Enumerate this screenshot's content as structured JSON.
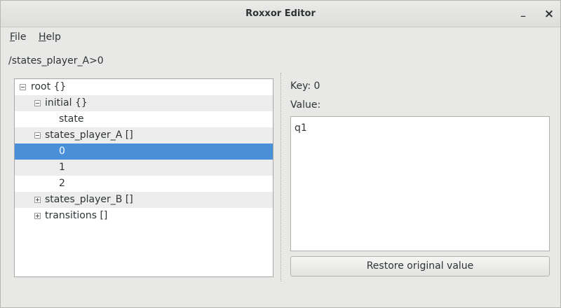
{
  "window": {
    "title": "Roxxor Editor",
    "minimize_glyph": "_",
    "close_glyph": "×"
  },
  "menu": {
    "file": {
      "accel": "F",
      "rest": "ile"
    },
    "help": {
      "accel": "H",
      "rest": "elp"
    }
  },
  "path": "/states_player_A>0",
  "tree": {
    "rows": [
      {
        "label": "root {}",
        "expander": "minus",
        "selected": false
      },
      {
        "label": "initial {}",
        "expander": "minus",
        "selected": false
      },
      {
        "label": "state",
        "expander": "none",
        "selected": false
      },
      {
        "label": "states_player_A []",
        "expander": "minus",
        "selected": false
      },
      {
        "label": "0",
        "expander": "none",
        "selected": true
      },
      {
        "label": "1",
        "expander": "none",
        "selected": false
      },
      {
        "label": "2",
        "expander": "none",
        "selected": false
      },
      {
        "label": "states_player_B []",
        "expander": "plus",
        "selected": false
      },
      {
        "label": "transitions []",
        "expander": "plus",
        "selected": false
      }
    ]
  },
  "detail": {
    "key_label": "Key: 0",
    "value_label": "Value:",
    "value": "q1",
    "restore_button": "Restore original value"
  },
  "colors": {
    "selection": "#4a90d9",
    "alt_row": "#ededed",
    "window_bg": "#e8e8e7"
  }
}
